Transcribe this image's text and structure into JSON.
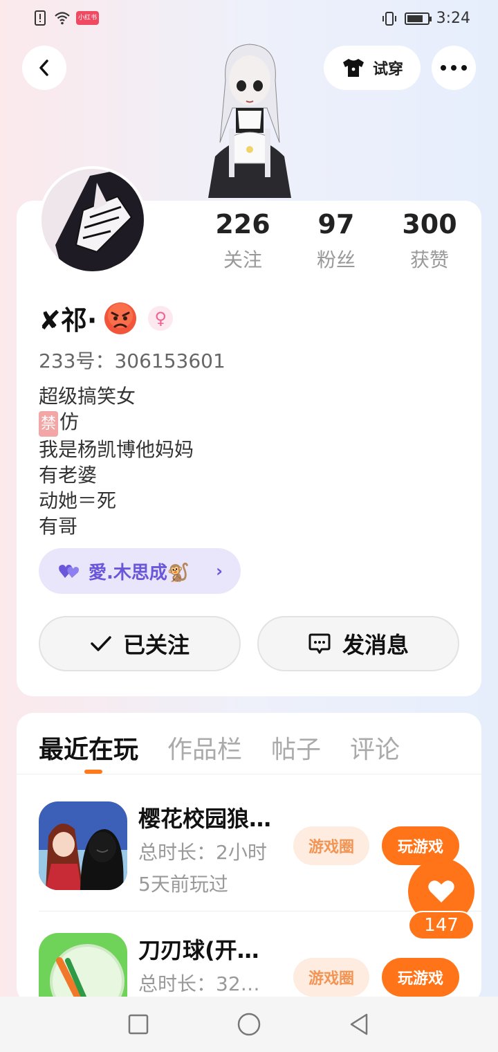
{
  "status_bar": {
    "time": "3:24",
    "carrier_badge": "小红书"
  },
  "header": {
    "tryon_label": "试穿"
  },
  "stats": [
    {
      "value": "226",
      "label": "关注"
    },
    {
      "value": "97",
      "label": "粉丝"
    },
    {
      "value": "300",
      "label": "获赞"
    }
  ],
  "profile": {
    "name": "✘祁·",
    "uid": "233号：306153601",
    "bio_line1": "超级搞笑女",
    "bio_tag": "禁",
    "bio_line2_rest": "仿",
    "bio_line3": "我是杨凯博他妈妈",
    "bio_line4": "有老婆",
    "bio_line5": "动她＝死",
    "bio_line6": "有哥",
    "cp_name": "愛.木思成🐒"
  },
  "actions": {
    "follow_label": "已关注",
    "message_label": "发消息"
  },
  "tabs": [
    "最近在玩",
    "作品栏",
    "帖子",
    "评论"
  ],
  "games": [
    {
      "title": "樱花校园狼…",
      "meta1": "总时长：2小时",
      "meta2": "5天前玩过",
      "circle_label": "游戏圈",
      "play_label": "玩游戏"
    },
    {
      "title": "刀刃球(开…",
      "meta1": "总时长：32…",
      "circle_label": "游戏圈",
      "play_label": "玩游戏"
    }
  ],
  "like": {
    "count": "147"
  },
  "colors": {
    "accent": "#ff7418",
    "cp_purple": "#6a56d9",
    "female_pink": "#f06493"
  }
}
